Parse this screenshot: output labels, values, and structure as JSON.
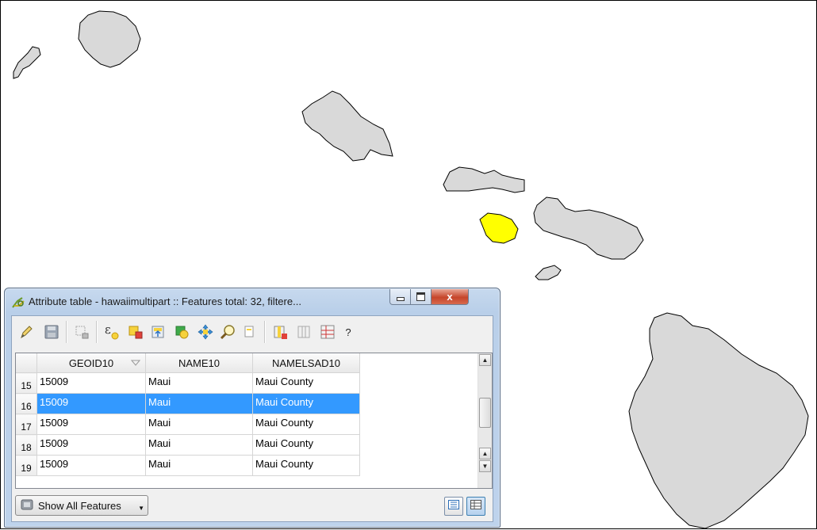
{
  "map": {
    "background": "#ffffff",
    "island_fill": "#d9d9d9",
    "island_stroke": "#000000",
    "selected_fill": "#ffff00",
    "islands": [
      {
        "name": "niihau-icon",
        "selected": false
      },
      {
        "name": "kauai-icon",
        "selected": false
      },
      {
        "name": "oahu-icon",
        "selected": false
      },
      {
        "name": "molokai-icon",
        "selected": false
      },
      {
        "name": "lanai-icon",
        "selected": true
      },
      {
        "name": "maui-icon",
        "selected": false
      },
      {
        "name": "kahoolawe-icon",
        "selected": false
      },
      {
        "name": "hawaii-big-island-icon",
        "selected": false
      }
    ]
  },
  "window": {
    "title": "Attribute table - hawaiimultipart :: Features total: 32, filtere...",
    "close_glyph": "x"
  },
  "toolbar": {
    "icons": [
      "edit-pencil-icon",
      "save-edits-icon",
      "delete-selected-icon",
      "select-by-expression-icon",
      "unselect-all-icon",
      "move-selection-to-top-icon",
      "invert-selection-icon",
      "pan-to-selection-icon",
      "zoom-to-selection-icon",
      "copy-selected-icon",
      "delete-column-icon",
      "new-column-icon",
      "field-calculator-icon"
    ],
    "help_label": "?"
  },
  "table": {
    "columns": [
      "GEOID10",
      "NAME10",
      "NAMELSAD10"
    ],
    "rows": [
      {
        "num": "15",
        "cells": [
          "15009",
          "Maui",
          "Maui County"
        ],
        "selected": false
      },
      {
        "num": "16",
        "cells": [
          "15009",
          "Maui",
          "Maui County"
        ],
        "selected": true
      },
      {
        "num": "17",
        "cells": [
          "15009",
          "Maui",
          "Maui County"
        ],
        "selected": false
      },
      {
        "num": "18",
        "cells": [
          "15009",
          "Maui",
          "Maui County"
        ],
        "selected": false
      },
      {
        "num": "19",
        "cells": [
          "15009",
          "Maui",
          "Maui County"
        ],
        "selected": false
      }
    ],
    "selection_color": "#3399ff"
  },
  "footer": {
    "filter_label": "Show All Features"
  }
}
